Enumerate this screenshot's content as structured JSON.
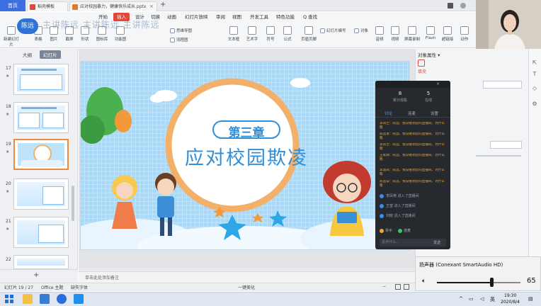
{
  "title_bar": {
    "home_tab": "首页",
    "tabs": [
      {
        "label": "稻壳模板",
        "icon_color": "#e0483a"
      },
      {
        "label": "应对校园暴力，健康快乐成长.pptx",
        "icon_color": "#e07a2f"
      }
    ],
    "new_tab_symbol": "+"
  },
  "presenter": {
    "name": "陈远",
    "watermark": "主讲陈远 主讲陈远 主讲陈远"
  },
  "ribbon": {
    "tabs": [
      "开始",
      "插入",
      "设计",
      "切换",
      "动画",
      "幻灯片放映",
      "审阅",
      "视图",
      "开发工具",
      "特色功能"
    ],
    "active_tab": "插入",
    "search_label": "Q 查找",
    "tools": [
      "新建幻灯片",
      "表格",
      "图片",
      "截屏",
      "形状",
      "图标库",
      "功能图",
      "思维导图",
      "流程图",
      "文本框",
      "艺术字",
      "符号",
      "公式",
      "页眉页脚",
      "幻灯片编号",
      "对象",
      "音频",
      "视频",
      "屏幕录制",
      "Flash",
      "超链接",
      "动作"
    ]
  },
  "left_panel": {
    "outline_tab": "大纲",
    "slides_tab": "幻灯片",
    "slides": [
      {
        "number": "17",
        "active": false
      },
      {
        "number": "18",
        "active": false
      },
      {
        "number": "19",
        "active": true
      },
      {
        "number": "20",
        "active": false
      },
      {
        "number": "21",
        "active": false
      },
      {
        "number": "22",
        "active": false
      }
    ],
    "add_symbol": "+"
  },
  "slide": {
    "chapter": "第三章",
    "title": "应对校园欺凌"
  },
  "notes": {
    "placeholder": "单击此处添加备注"
  },
  "right_panel": {
    "title": "对象属性 ▾",
    "tab": "填充"
  },
  "chat": {
    "stats": [
      {
        "value": "8",
        "label": "累计观看"
      },
      {
        "value": "5",
        "label": "在线"
      }
    ],
    "tabs": [
      "讨论",
      "连麦",
      "设置"
    ],
    "messages": [
      "李凤兰：陈远、我没看到您的直播间、为什么嗯",
      "陈远发：陈远、我没看到您的直播间、为什么嗯",
      "李凤芝：陈远、我没看到您的直播间、为什么嗯",
      "王家霖：陈远、我没看到您的直播间、为什么嗯",
      "李淑凤：陈远、我没看到您的直播间、为什么嗯",
      "陈远安：陈远、我没看到您的直播间、为什么嗯"
    ],
    "users": [
      "李凤英 进入了直播间",
      "王莹 进入了直播间",
      "刘晓 进入了直播间"
    ],
    "flags": [
      "举手",
      "连麦"
    ],
    "input_placeholder": "说点什么…",
    "send_label": "发送"
  },
  "status_bar": {
    "slide_counter": "幻灯片 19 / 27",
    "theme": "Office 主题",
    "font_missing": "缺失字体",
    "beautify": "一键美化",
    "zoom_minus": "−"
  },
  "volume": {
    "device": "扬声器 (Conexant SmartAudio HD)",
    "level": 65,
    "level_text": "65"
  },
  "taskbar": {
    "time": "19:30",
    "date": "2020/8/4",
    "ime": "英"
  },
  "colors": {
    "accent_red": "#e0483a",
    "accent_blue": "#2f73d6",
    "slide_sky": "#bde4fb",
    "chat_bg": "#26292e",
    "chat_msg": "#e7a63c"
  }
}
